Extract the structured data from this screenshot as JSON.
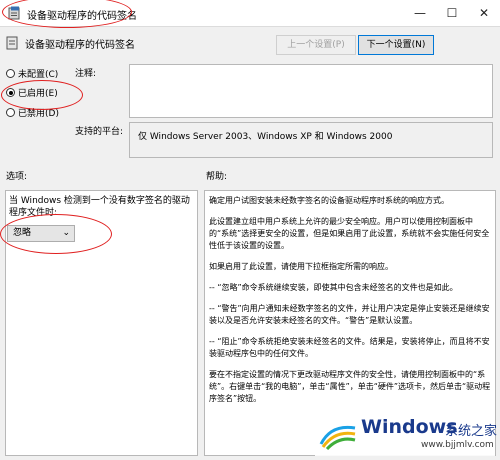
{
  "window": {
    "title": "设备驱动程序的代码签名",
    "min_symbol": "—",
    "max_symbol": "☐",
    "close_symbol": "✕"
  },
  "header": {
    "setting_name": "设备驱动程序的代码签名",
    "prev_button": "上一个设置(P)",
    "next_button": "下一个设置(N)"
  },
  "state": {
    "options": [
      {
        "label": "未配置(C)",
        "selected": false
      },
      {
        "label": "已启用(E)",
        "selected": true
      },
      {
        "label": "已禁用(D)",
        "selected": false
      }
    ]
  },
  "fields": {
    "comment_label": "注释:",
    "comment_value": "",
    "platform_label": "支持的平台:",
    "platform_value": "仅 Windows Server 2003、Windows XP 和 Windows 2000"
  },
  "sections": {
    "options_label": "选项:",
    "help_label": "帮助:"
  },
  "options_panel": {
    "prompt": "当 Windows 检测到一个没有数字签名的驱动程序文件时:",
    "select_value": "忽略"
  },
  "help": {
    "paragraphs": [
      "确定用户试图安装未经数字签名的设备驱动程序时系统的响应方式。",
      "此设置建立组中用户系统上允许的最少安全响应。用户可以使用控制面板中的“系统”选择更安全的设置，但是如果启用了此设置，系统就不会实施任何安全性低于该设置的设置。",
      "如果启用了此设置，请使用下拉框指定所需的响应。",
      "-- “忽略”命令系统继续安装，即使其中包含未经签名的文件也是如此。",
      "-- “警告”向用户通知未经数字签名的文件，并让用户决定是停止安装还是继续安装以及是否允许安装未经签名的文件。“警告”是默认设置。",
      "-- “阻止”命令系统拒绝安装未经签名的文件。结果是，安装将停止，而且将不安装驱动程序包中的任何文件。",
      "要在不指定设置的情况下更改驱动程序文件的安全性，请使用控制面板中的“系统”。右键单击“我的电脑”，单击“属性”，单击“硬件”选项卡，然后单击“驱动程序签名”按钮。"
    ]
  },
  "watermark": {
    "brand": "Windows",
    "cn": "系统之家",
    "url": "www.bjjmlv.com"
  },
  "colors": {
    "annotation": "#e02020",
    "accent": "#0078d7"
  }
}
